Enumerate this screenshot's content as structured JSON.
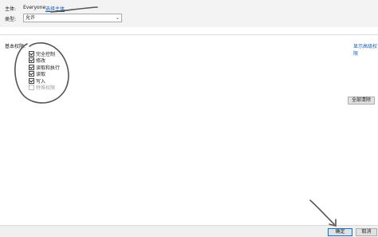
{
  "principal": {
    "label": "主体:",
    "value": "Everyone",
    "link": "选择主体"
  },
  "type": {
    "label": "类型:",
    "selected": "允许"
  },
  "basic_permissions": {
    "title": "基本权限:",
    "show_advanced": "显示高级权限",
    "items": [
      {
        "label": "完全控制",
        "checked": true,
        "disabled": false
      },
      {
        "label": "修改",
        "checked": true,
        "disabled": false
      },
      {
        "label": "读取和执行",
        "checked": true,
        "disabled": false
      },
      {
        "label": "读取",
        "checked": true,
        "disabled": false
      },
      {
        "label": "写入",
        "checked": true,
        "disabled": false
      },
      {
        "label": "特殊权限",
        "checked": false,
        "disabled": true
      }
    ],
    "clear_all": "全部清除"
  },
  "buttons": {
    "ok": "确定",
    "cancel": "取消"
  },
  "colors": {
    "link": "#1a5fb4",
    "annotation": "#555555"
  }
}
